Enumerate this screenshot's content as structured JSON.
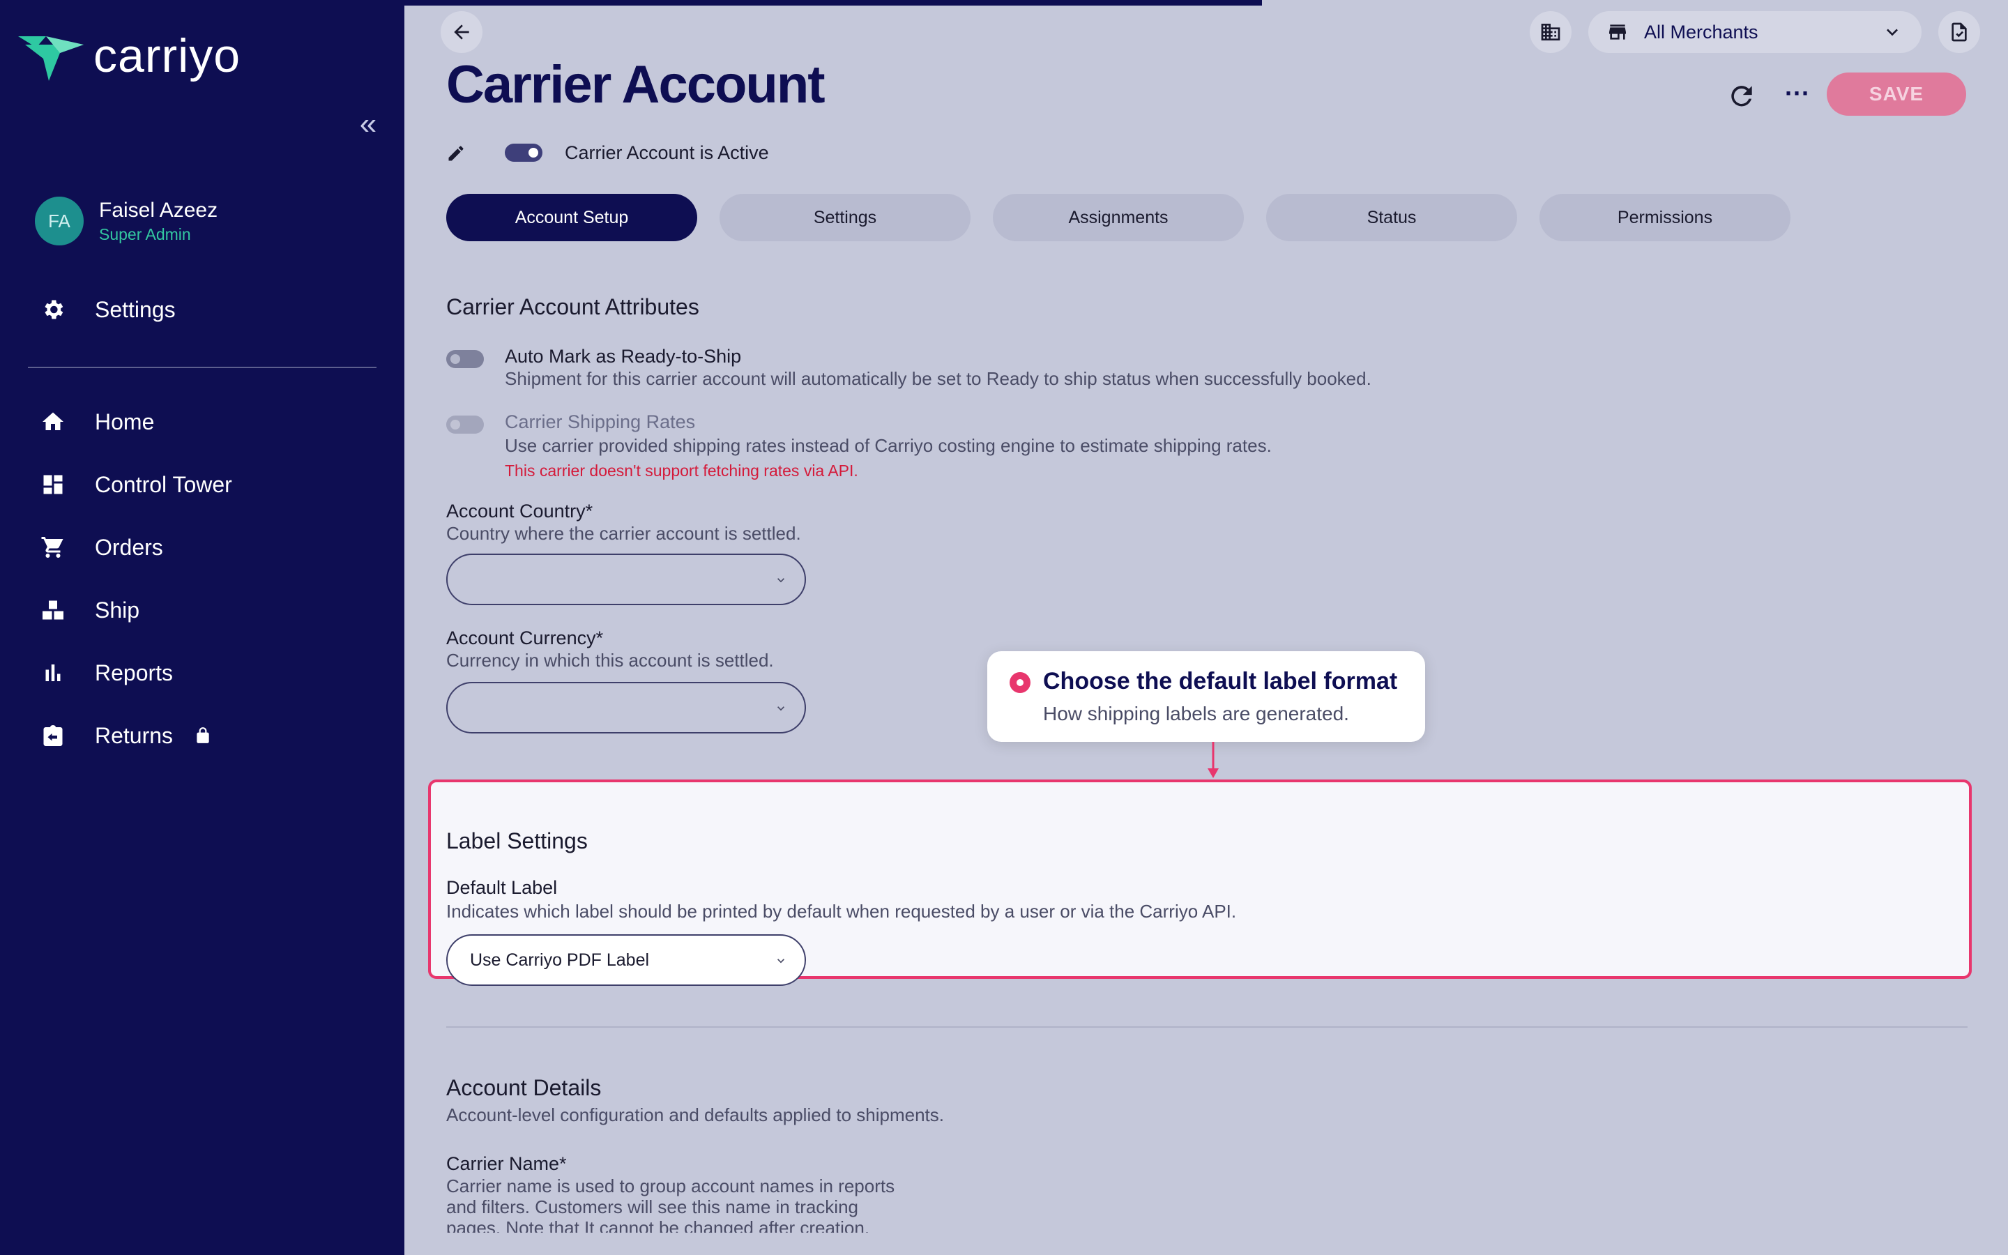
{
  "sidebar": {
    "logo_text": "carriyo",
    "user": {
      "initials": "FA",
      "name": "Faisel Azeez",
      "role": "Super Admin"
    },
    "settings_label": "Settings",
    "items": [
      {
        "label": "Home",
        "icon": "home-icon"
      },
      {
        "label": "Control Tower",
        "icon": "dashboard-icon"
      },
      {
        "label": "Orders",
        "icon": "cart-icon"
      },
      {
        "label": "Ship",
        "icon": "boxes-icon"
      },
      {
        "label": "Reports",
        "icon": "bar-chart-icon"
      },
      {
        "label": "Returns",
        "icon": "return-box-icon",
        "locked": true
      }
    ]
  },
  "header": {
    "title": "Carrier Account",
    "merchant_select": "All Merchants",
    "save_label": "SAVE",
    "active_label": "Carrier Account is Active",
    "active": true
  },
  "tabs": [
    {
      "label": "Account Setup",
      "active": true
    },
    {
      "label": "Settings",
      "active": false
    },
    {
      "label": "Assignments",
      "active": false
    },
    {
      "label": "Status",
      "active": false
    },
    {
      "label": "Permissions",
      "active": false
    }
  ],
  "attributes": {
    "title": "Carrier Account Attributes",
    "auto_mark": {
      "title": "Auto Mark as Ready-to-Ship",
      "desc": "Shipment for this carrier account will automatically be set to Ready to ship status when successfully booked."
    },
    "shipping_rates": {
      "title": "Carrier Shipping Rates",
      "desc": "Use carrier provided shipping rates instead of Carriyo costing engine to estimate shipping rates.",
      "error": "This carrier doesn't support fetching rates via API."
    },
    "country": {
      "label": "Account Country*",
      "help": "Country where the carrier account is settled.",
      "value": ""
    },
    "currency": {
      "label": "Account Currency*",
      "help": "Currency in which this account is settled.",
      "value": ""
    }
  },
  "label_settings": {
    "title": "Label Settings",
    "default_label": "Default Label",
    "help": "Indicates which label should be printed by default when requested by a user or via the Carriyo API.",
    "value": "Use Carriyo PDF Label"
  },
  "tooltip": {
    "title": "Choose the default label format",
    "subtitle": "How shipping labels are generated."
  },
  "account_details": {
    "title": "Account Details",
    "desc": "Account-level configuration and defaults applied to shipments.",
    "carrier_name_label": "Carrier Name*",
    "carrier_name_help_1": "Carrier name is used to group account names in reports",
    "carrier_name_help_2": "and filters. Customers will see this name in tracking",
    "carrier_name_help_3": "pages. Note that It cannot be changed after creation."
  },
  "colors": {
    "sidebar_bg": "#0e0e52",
    "accent_pink": "#e8366d",
    "save_bg": "#e07a9c",
    "content_bg": "#c5c8da"
  }
}
